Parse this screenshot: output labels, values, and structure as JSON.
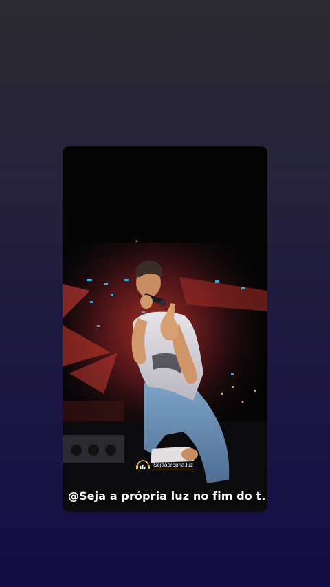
{
  "video": {
    "caption": "@Seja a própria luz no fim do t...",
    "watermark_label": "Sejaapropria.luz",
    "accent_color": "#f2c230",
    "lyric_overlay": ""
  },
  "colors": {
    "background_top": "#2b2a30",
    "background_bottom": "#130d45",
    "card_background": "#000000"
  },
  "icons": {
    "watermark": "equalizer-headphones-icon"
  }
}
